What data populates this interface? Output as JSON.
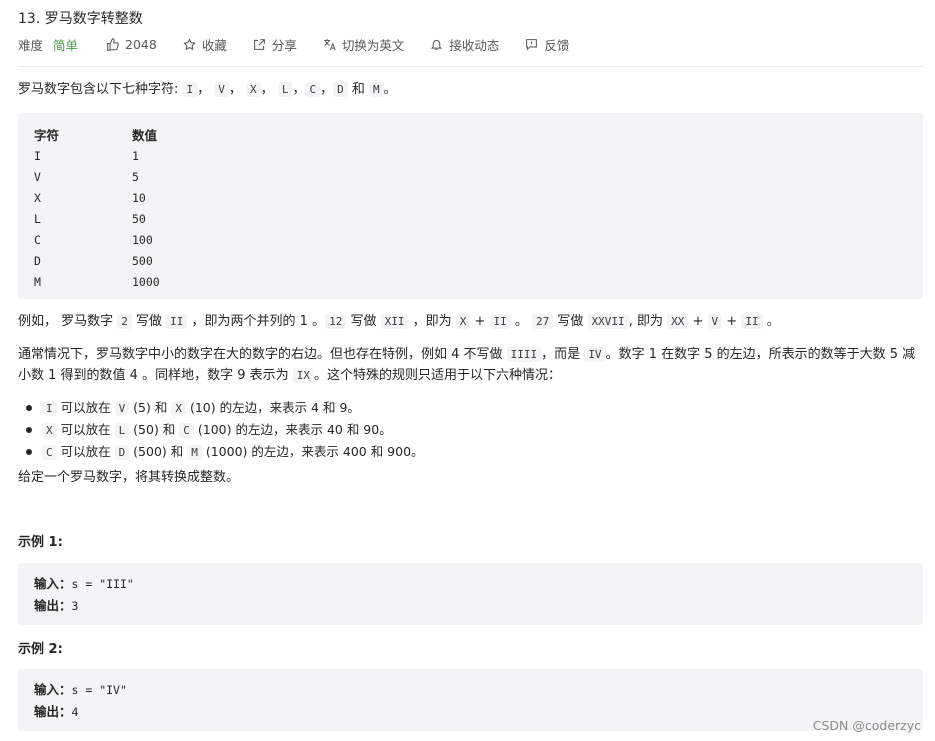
{
  "title": "13. 罗马数字转整数",
  "meta": {
    "difficulty_label": "难度",
    "difficulty_value": "简单",
    "likes": "2048",
    "favorite": "收藏",
    "share": "分享",
    "switch_lang": "切换为英文",
    "notify": "接收动态",
    "feedback": "反馈"
  },
  "intro": {
    "prefix": "罗马数字包含以下七种字符: ",
    "symbols": [
      "I",
      "V",
      "X",
      "L",
      "C",
      "D",
      "M"
    ],
    "and": "和",
    "end": "。"
  },
  "table": {
    "header": [
      "字符",
      "数值"
    ],
    "rows": [
      [
        "I",
        "1"
      ],
      [
        "V",
        "5"
      ],
      [
        "X",
        "10"
      ],
      [
        "L",
        "50"
      ],
      [
        "C",
        "100"
      ],
      [
        "D",
        "500"
      ],
      [
        "M",
        "1000"
      ]
    ]
  },
  "example_para": {
    "t1": "例如， 罗马数字 ",
    "c1": "2",
    "t2": " 写做 ",
    "c2": "II",
    "t3": " ，即为两个并列的 1 。",
    "c3": "12",
    "t4": " 写做 ",
    "c4": "XII",
    "t5": " ，即为 ",
    "c5": "X",
    "t6": " + ",
    "c6": "II",
    "t7": " 。 ",
    "c7": "27",
    "t8": " 写做  ",
    "c8": "XXVII",
    "t9": ", 即为 ",
    "c9": "XX",
    "t10": " + ",
    "c10": "V",
    "t11": " + ",
    "c11": "II",
    "t12": " 。"
  },
  "rule_para": {
    "t1": "通常情况下，罗马数字中小的数字在大的数字的右边。但也存在特例，例如 4 不写做 ",
    "c1": "IIII",
    "t2": "，而是 ",
    "c2": "IV",
    "t3": "。数字 1 在数字 5 的左边，所表示的数等于大数 5 减小数 1 得到的数值 4 。同样地，数字 9 表示为 ",
    "c3": "IX",
    "t4": "。这个特殊的规则只适用于以下六种情况："
  },
  "bullets": [
    {
      "a": "I",
      "t1": " 可以放在 ",
      "b": "V",
      "t2": " (5) 和 ",
      "c": "X",
      "t3": " (10) 的左边，来表示 4 和 9。"
    },
    {
      "a": "X",
      "t1": " 可以放在 ",
      "b": "L",
      "t2": " (50) 和 ",
      "c": "C",
      "t3": " (100) 的左边，来表示 40 和 90。"
    },
    {
      "a": "C",
      "t1": " 可以放在 ",
      "b": "D",
      "t2": " (500) 和 ",
      "c": "M",
      "t3": " (1000) 的左边，来表示 400 和 900。"
    }
  ],
  "task": "给定一个罗马数字，将其转换成整数。",
  "examples": [
    {
      "title": "示例 1:",
      "input_label": "输入：",
      "input": "s = \"III\"",
      "output_label": "输出：",
      "output": "3"
    },
    {
      "title": "示例 2:",
      "input_label": "输入：",
      "input": "s = \"IV\"",
      "output_label": "输出：",
      "output": "4"
    }
  ],
  "watermark": "CSDN @coderzyc",
  "colors": {
    "easy_green": "#43a047",
    "code_bg": "#f3f4f5",
    "text": "#262626"
  }
}
